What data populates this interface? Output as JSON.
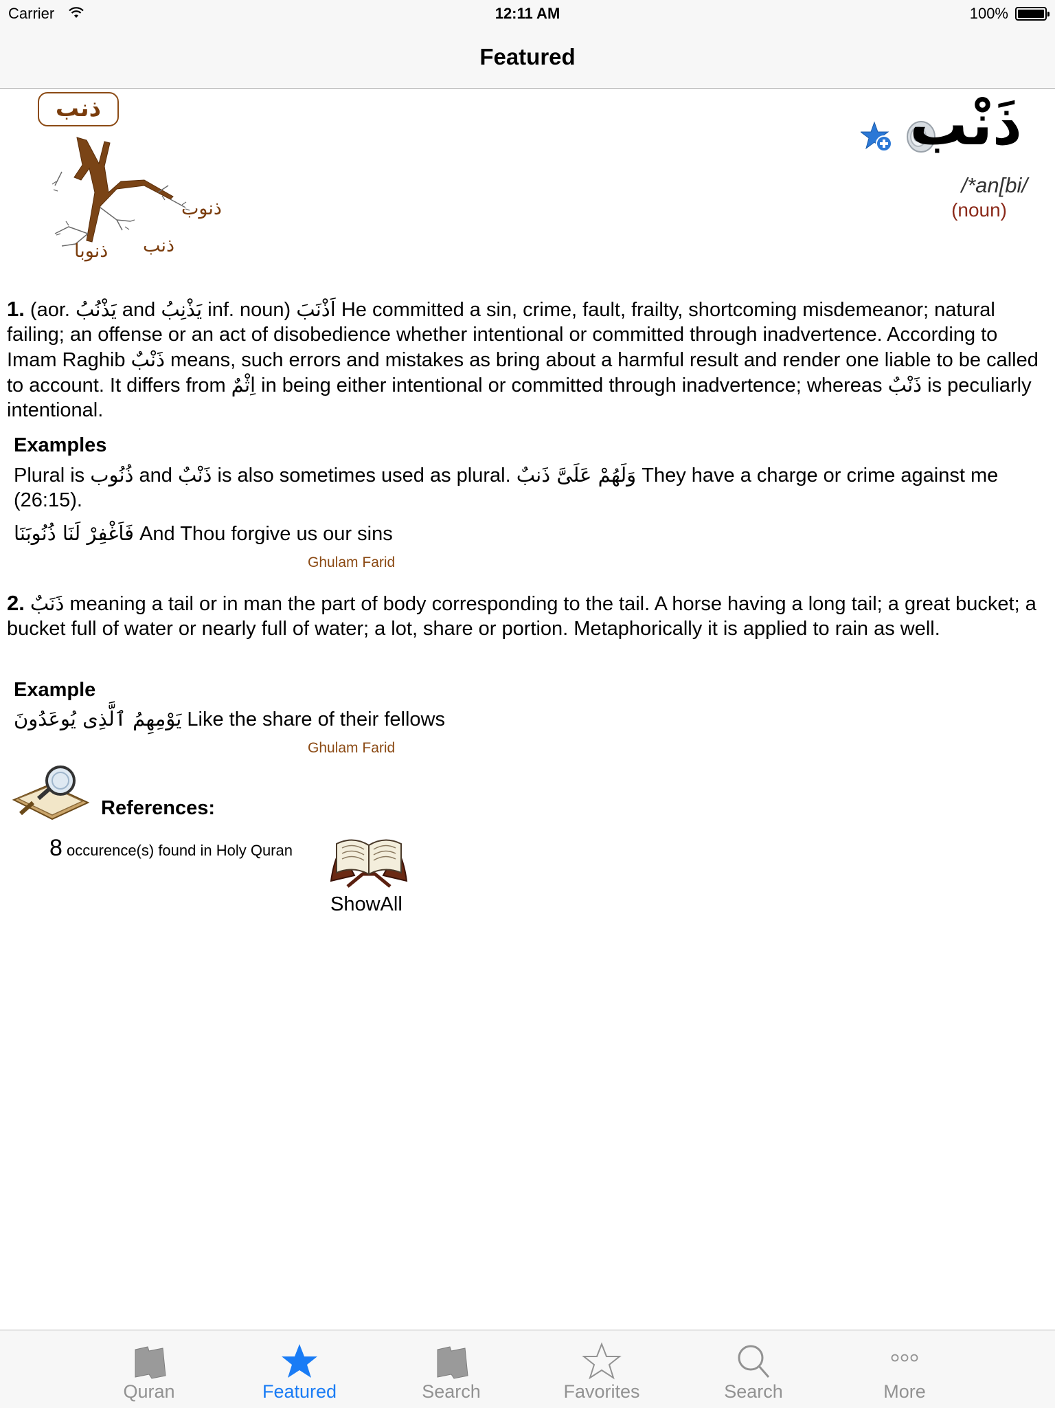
{
  "status": {
    "carrier": "Carrier",
    "time": "12:11 AM",
    "battery": "100%"
  },
  "nav": {
    "title": "Featured"
  },
  "word": {
    "root_badge": "ذنب",
    "branch_labels": [
      "ذنوب",
      "ذنب",
      "ذنوبا"
    ],
    "headword": "ذَنْب",
    "transliteration": "/*an[bi/",
    "part_of_speech": "(noun)"
  },
  "sense1": {
    "num": "1.",
    "text_a": " (aor. ",
    "ar_a": "يَذْنُبُ",
    "text_b": " and ",
    "ar_b": "يَذْنِبُ",
    "text_c": " inf. noun)  ",
    "ar_c": "اَذْنَبَ",
    "text_d": " He committed a sin, crime, fault, frailty, shortcoming misdemeanor; natural failing; an offense or an act of disobedience whether intentional or committed through inadvertence. According to Imam Raghib ",
    "ar_d": "ذَنْبٌ",
    "text_e": " means, such errors and mistakes as bring about a harmful result and render one liable to be called to account. It differs from ",
    "ar_e": "اِثْمٌ",
    "text_f": " in being either intentional or committed through inadvertence; whereas ",
    "ar_f": "ذَنْبٌ",
    "text_g": " is peculiarly intentional."
  },
  "examples1": {
    "heading": "Examples",
    "line1_a": "Plural is ",
    "line1_ar1": "ذُنُوب",
    "line1_b": " and ",
    "line1_ar2": "ذَنْبٌ",
    "line1_c": " is also sometimes used as plural. ",
    "line1_ar3": "وَلَهُمْ عَلَىَّ ذَنبٌ",
    "line1_d": " They have a charge or crime against me (26:15).",
    "line2_ar": "فَاَغْفِرْ لَنَا ذُنُوبَنَا",
    "line2_text": " And Thou forgive us our sins",
    "credit": "Ghulam Farid"
  },
  "sense2": {
    "num": "2.",
    "ar": "ذَنَبٌ",
    "text": " meaning a tail or in man the part of body corresponding to the tail. A horse having a long tail; a great bucket; a bucket full of water or nearly full of water; a lot, share or portion. Metaphorically it is applied to rain as well."
  },
  "example2": {
    "heading": "Example",
    "ar": "يَوْمِهِمُ ٱلَّذِى يُوعَدُونَ",
    "text": " Like the share of their fellows",
    "credit": "Ghulam Farid"
  },
  "references": {
    "title": "References:",
    "count": "8",
    "count_text": "occurence(s) found in Holy Quran",
    "show_all": "ShowAll"
  },
  "tabs": [
    {
      "label": "Quran",
      "icon": "quran-book-icon"
    },
    {
      "label": "Featured",
      "icon": "star-filled-icon"
    },
    {
      "label": "Search",
      "icon": "quran-book-icon"
    },
    {
      "label": "Favorites",
      "icon": "star-outline-icon"
    },
    {
      "label": "Search",
      "icon": "magnifier-icon"
    },
    {
      "label": "More",
      "icon": "more-dots-icon"
    }
  ],
  "colors": {
    "active_tab": "#1a7cf5",
    "inactive_tab": "#929292",
    "brown": "#7a3c0c",
    "pos": "#8b2a1a"
  }
}
